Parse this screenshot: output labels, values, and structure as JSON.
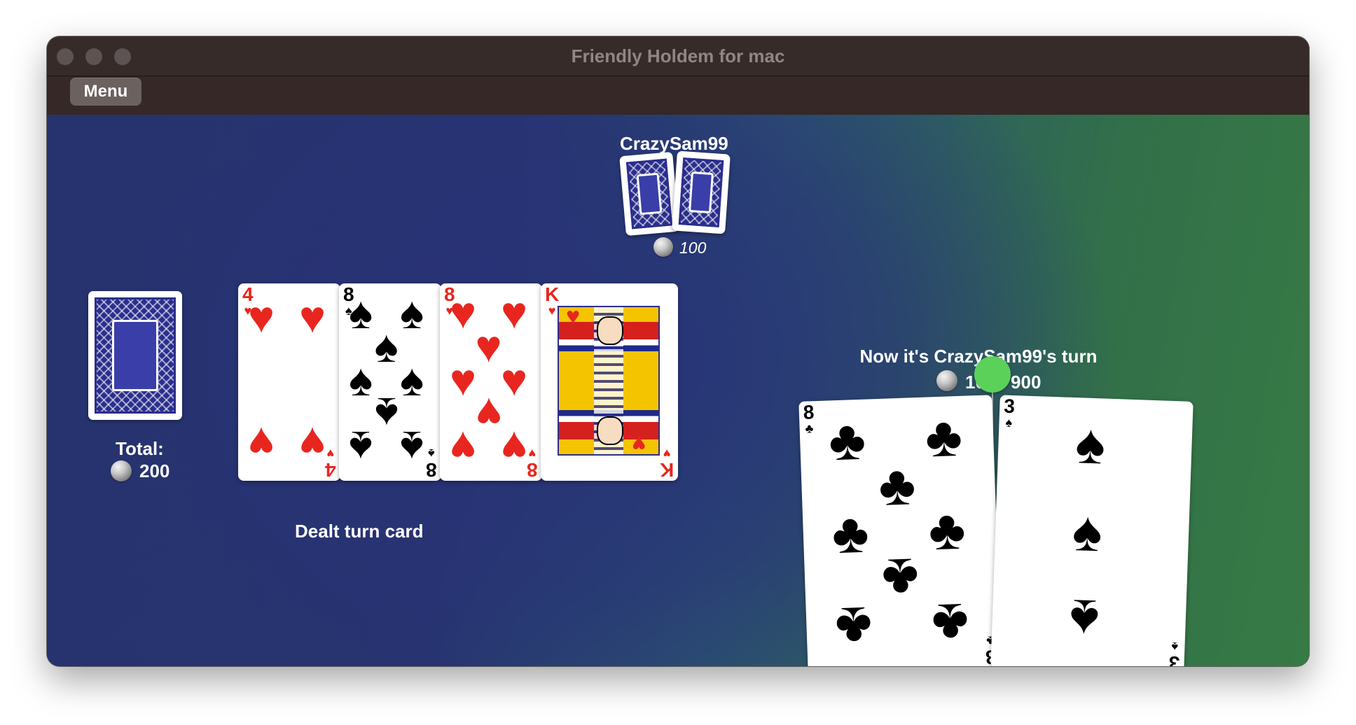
{
  "window": {
    "title": "Friendly Holdem for mac"
  },
  "toolbar": {
    "menu_label": "Menu"
  },
  "opponent": {
    "name": "CrazySam99",
    "bet": "100"
  },
  "pot": {
    "label": "Total:",
    "amount": "200"
  },
  "status": {
    "message": "Dealt turn card"
  },
  "turn": {
    "message": "Now it's CrazySam99's turn",
    "chips": "100 / 900"
  },
  "community_cards": [
    {
      "rank": "4",
      "suit": "♥",
      "color": "#e8261f"
    },
    {
      "rank": "8",
      "suit": "♠",
      "color": "#000000"
    },
    {
      "rank": "8",
      "suit": "♥",
      "color": "#e8261f"
    },
    {
      "rank": "K",
      "suit": "♥",
      "color": "#e8261f"
    }
  ],
  "player_cards": [
    {
      "rank": "8",
      "suit": "♣",
      "color": "#000000"
    },
    {
      "rank": "3",
      "suit": "♠",
      "color": "#000000"
    }
  ],
  "colors": {
    "table_blue": "#27336f",
    "table_green": "#377a45",
    "turn_indicator": "#5bd15a",
    "card_back": "#2b2e8c"
  },
  "icons": {
    "chip": "chip-icon",
    "card_back": "card-back-icon",
    "turn_indicator": "turn-indicator-icon"
  }
}
